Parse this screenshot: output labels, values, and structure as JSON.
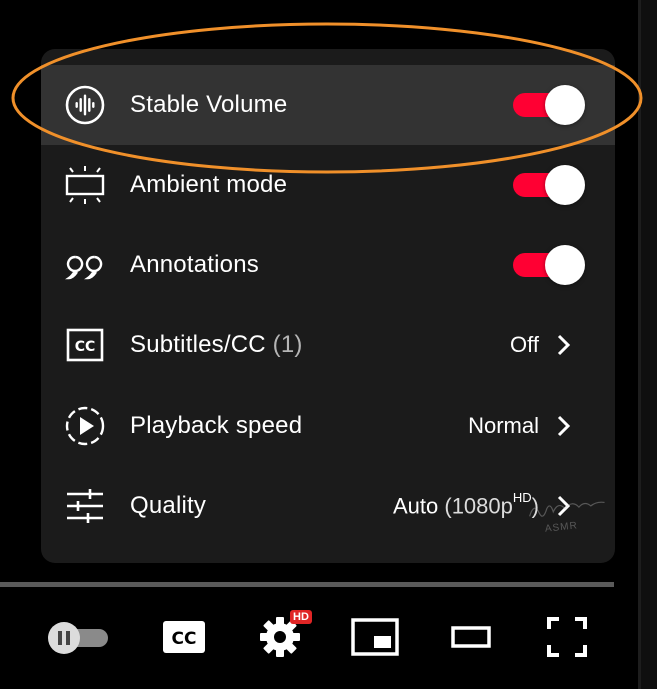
{
  "settings_menu": {
    "items": [
      {
        "label": "Stable Volume",
        "icon": "stable-volume-icon",
        "type": "toggle",
        "on": true
      },
      {
        "label": "Ambient mode",
        "icon": "ambient-mode-icon",
        "type": "toggle",
        "on": true
      },
      {
        "label": "Annotations",
        "icon": "annotations-icon",
        "type": "toggle",
        "on": true
      },
      {
        "label": "Subtitles/CC",
        "count": "(1)",
        "icon": "cc-icon",
        "type": "submenu",
        "value": "Off"
      },
      {
        "label": "Playback speed",
        "icon": "playback-speed-icon",
        "type": "submenu",
        "value": "Normal"
      },
      {
        "label": "Quality",
        "icon": "quality-sliders-icon",
        "type": "submenu",
        "value_main": "Auto",
        "value_paren": "(1080p",
        "value_sup": "HD",
        "value_close": ")"
      }
    ]
  },
  "watermark": {
    "line1": "ASMR"
  },
  "controls": {
    "autoplay_toggle": "autoplay-pause-icon",
    "subtitles_button": "CC",
    "settings_badge": "HD",
    "miniplayer": "miniplayer-icon",
    "theater": "theater-mode-icon",
    "fullscreen": "fullscreen-icon"
  },
  "colors": {
    "menu_bg": "#1c1c1c",
    "highlight_row": "#333333",
    "toggle_on": "#ff0033",
    "annotation_ring": "#f0902a",
    "badge": "#e02525"
  }
}
